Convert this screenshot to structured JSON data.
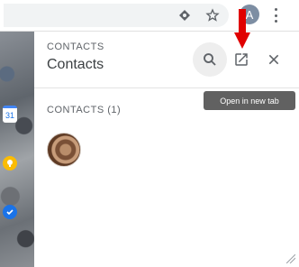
{
  "browser": {
    "icons": [
      "extension-icon",
      "star-icon",
      "menu-icon"
    ],
    "profile_initial": "A"
  },
  "panel": {
    "subtitle": "CONTACTS",
    "title": "Contacts",
    "section_label": "CONTACTS (1)",
    "tooltip": "Open in new tab",
    "icons": [
      "search-icon",
      "open-in-new-icon",
      "close-icon"
    ]
  },
  "left_apps": {
    "calendar_text": "31"
  },
  "colors": {
    "annotation_arrow": "#e00000",
    "tooltip_bg": "#616161",
    "search_button_bg": "#eeeeee"
  }
}
